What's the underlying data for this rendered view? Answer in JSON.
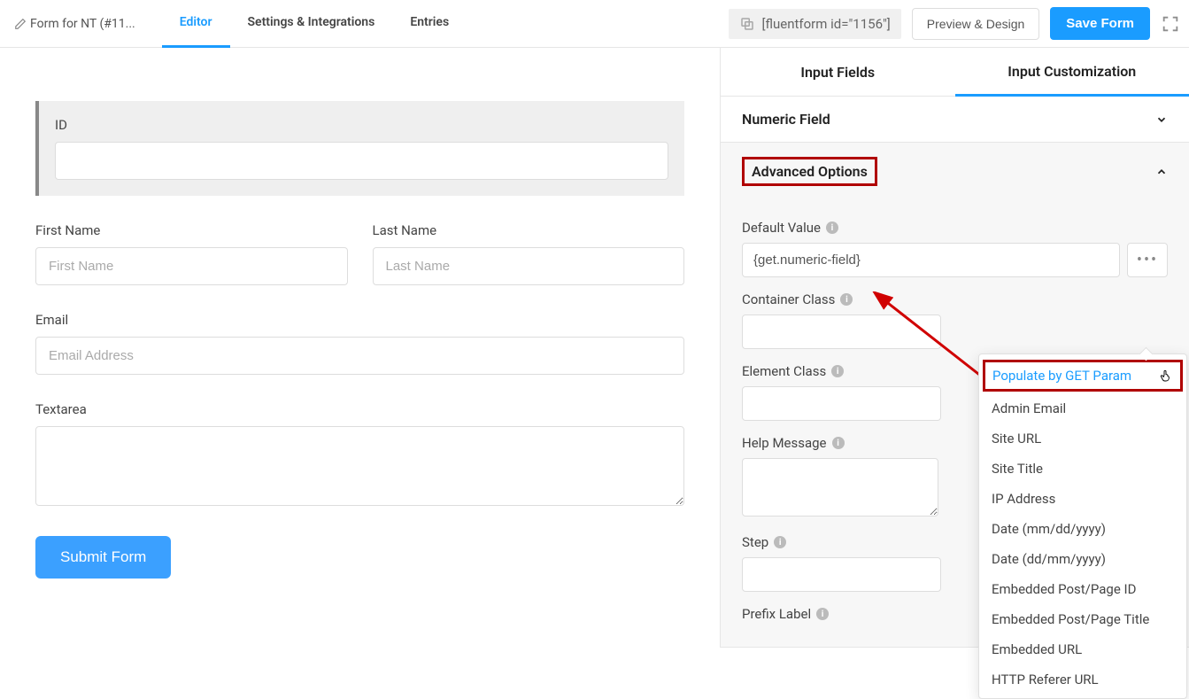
{
  "topbar": {
    "form_title": "Form for NT (#11...",
    "tabs": {
      "editor": "Editor",
      "settings": "Settings & Integrations",
      "entries": "Entries"
    },
    "shortcode": "[fluentform id=\"1156\"]",
    "preview_btn": "Preview & Design",
    "save_btn": "Save Form"
  },
  "form": {
    "id_label": "ID",
    "first_name_label": "First Name",
    "first_name_placeholder": "First Name",
    "last_name_label": "Last Name",
    "last_name_placeholder": "Last Name",
    "email_label": "Email",
    "email_placeholder": "Email Address",
    "textarea_label": "Textarea",
    "submit_label": "Submit Form"
  },
  "sidebar": {
    "tabs": {
      "input_fields": "Input Fields",
      "input_customization": "Input Customization"
    },
    "numeric_panel": "Numeric Field",
    "advanced_panel": "Advanced Options",
    "opts": {
      "default_value_label": "Default Value",
      "default_value_input": "{get.numeric-field}",
      "container_class_label": "Container Class",
      "element_class_label": "Element Class",
      "help_message_label": "Help Message",
      "step_label": "Step",
      "prefix_label_label": "Prefix Label"
    },
    "dropdown": {
      "populate_get": "Populate by GET Param",
      "admin_email": "Admin Email",
      "site_url": "Site URL",
      "site_title": "Site Title",
      "ip_address": "IP Address",
      "date_mdy": "Date (mm/dd/yyyy)",
      "date_dmy": "Date (dd/mm/yyyy)",
      "embedded_id": "Embedded Post/Page ID",
      "embedded_title": "Embedded Post/Page Title",
      "embedded_url": "Embedded URL",
      "http_referer": "HTTP Referer URL"
    }
  }
}
